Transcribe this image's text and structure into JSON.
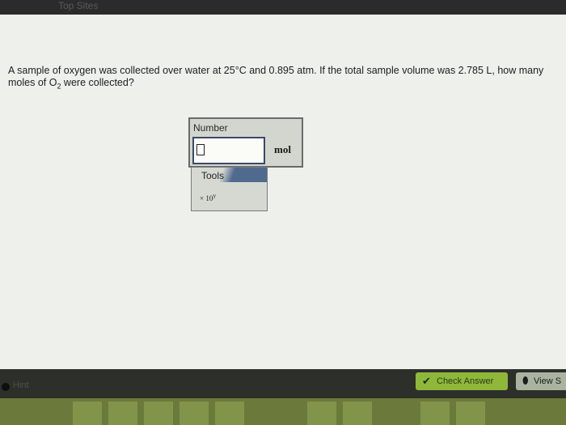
{
  "top_bar": {
    "label": "Top Sites"
  },
  "question": {
    "text_before": "A sample of oxygen was collected over water at 25°C and 0.895 atm. If the total sample volume was 2.785 L, how many moles of O",
    "subscript": "2",
    "text_after": " were collected?"
  },
  "answer": {
    "title": "Number",
    "value": "",
    "unit": "mol"
  },
  "tools": {
    "label": "Tools",
    "sci_label": "× 10",
    "sci_exp": "y"
  },
  "footer": {
    "hint": "Hint",
    "check_label": "Check Answer",
    "view_label": "View S"
  }
}
